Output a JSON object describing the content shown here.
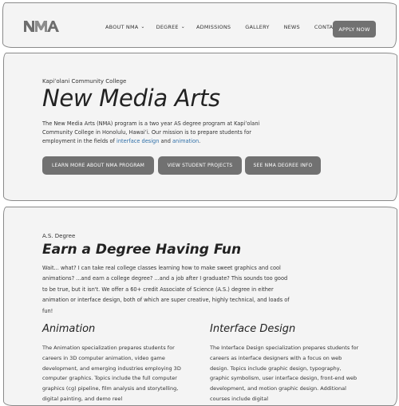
{
  "nav": {
    "logo_text": "NMA",
    "links": [
      {
        "label": "ABOUT NMA",
        "dropdown": true
      },
      {
        "label": "DEGREE",
        "dropdown": true
      },
      {
        "label": "ADMISSIONS",
        "dropdown": false
      },
      {
        "label": "GALLERY",
        "dropdown": false
      },
      {
        "label": "NEWS",
        "dropdown": false
      },
      {
        "label": "CONTACT",
        "dropdown": false
      }
    ],
    "apply_label": "APPLY NOW"
  },
  "hero": {
    "college": "Kapiʻolani Community College",
    "title": "New Media Arts",
    "body_before": "The New Media Arts (NMA) program is a two year AS degree program at Kapiʻolani Community College in Honolulu, Hawaiʻi. Our mission is to prepare students for employment in the fields of ",
    "link_interface": "interface design",
    "body_and": " and ",
    "link_animation": "animation",
    "body_end": ".",
    "buttons": [
      "LEARN MORE ABOUT NMA PROGRAM",
      "VIEW STUDENT PROJECTS",
      "SEE NMA DEGREE INFO"
    ]
  },
  "degree": {
    "kicker": "A.S. Degree",
    "title": "Earn a Degree Having Fun",
    "body": "Wait... what? I can take real college classes learning how to make sweet graphics and cool animations? ...and earn a college degree? ...and a job after I graduate? This sounds too good to be true, but it isn't. We offer a 60+ credit Associate of Science (A.S.) degree in either animation or interface design, both of which are super creative, highly technical, and loads of fun!",
    "animation": {
      "title": "Animation",
      "body": "The Animation specialization prepares students for careers in 3D computer animation, video game development, and emerging industries employing 3D computer graphics. Topics include the full computer graphics (cg) pipeline, film analysis and storytelling, digital painting, and demo reel"
    },
    "interface": {
      "title": "Interface Design",
      "body": "The Interface Design specialization prepares students for careers as interface designers with a focus on web design. Topics include graphic design, typography, graphic symbolism, user interface design, front-end web development, and motion graphic design. Additional courses include digital"
    }
  },
  "colors": {
    "panel_bg": "#f4f4f4",
    "button_bg": "#717171",
    "link": "#2e6fa8"
  },
  "icons": [
    "nma-logo-icon",
    "chevron-down-icon"
  ]
}
